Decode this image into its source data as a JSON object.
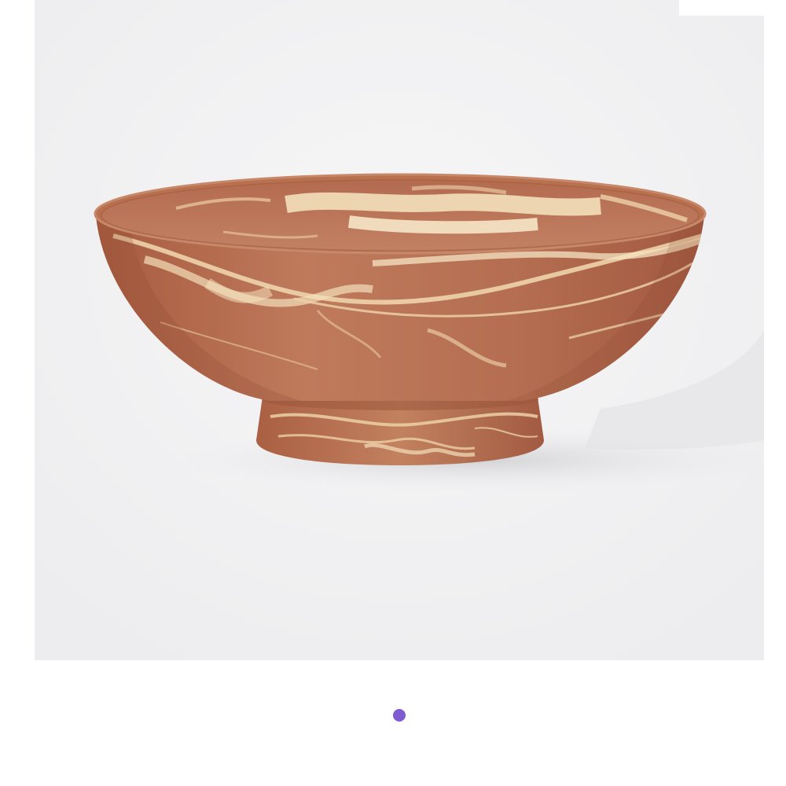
{
  "product_image": {
    "icon": "marbled-terracotta-footed-bowl",
    "colors": {
      "background": "#f4f4f5",
      "clay": "#b36a4e",
      "swirl": "#f1d9b0"
    }
  },
  "pagination": {
    "count": 1,
    "active_index": 0,
    "active_color": "#7e5bd0"
  }
}
